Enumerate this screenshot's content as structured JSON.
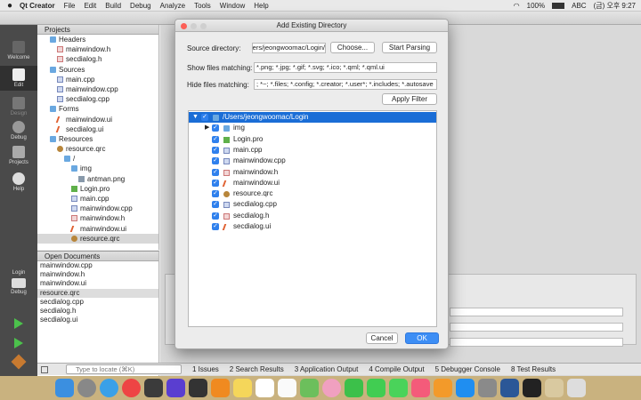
{
  "menubar": {
    "apple": "",
    "items": [
      "Qt Creator",
      "File",
      "Edit",
      "Build",
      "Debug",
      "Analyze",
      "Tools",
      "Window",
      "Help"
    ],
    "battery": "100%",
    "input": "ABC",
    "clock": "(금) 오후 9:27"
  },
  "modes": [
    "Welcome",
    "Edit",
    "Design",
    "Debug",
    "Projects",
    "Help"
  ],
  "kit": {
    "project": "Login",
    "mode": "Debug"
  },
  "projects_panel": {
    "title": "Projects",
    "tree": [
      {
        "label": "Headers",
        "icon": "folder-icon"
      },
      {
        "label": "mainwindow.h",
        "icon": "header-file-icon"
      },
      {
        "label": "secdialog.h",
        "icon": "header-file-icon"
      },
      {
        "label": "Sources",
        "icon": "folder-icon"
      },
      {
        "label": "main.cpp",
        "icon": "cpp-file-icon"
      },
      {
        "label": "mainwindow.cpp",
        "icon": "cpp-file-icon"
      },
      {
        "label": "secdialog.cpp",
        "icon": "cpp-file-icon"
      },
      {
        "label": "Forms",
        "icon": "folder-icon"
      },
      {
        "label": "mainwindow.ui",
        "icon": "ui-file-icon"
      },
      {
        "label": "secdialog.ui",
        "icon": "ui-file-icon"
      },
      {
        "label": "Resources",
        "icon": "folder-icon"
      },
      {
        "label": "resource.qrc",
        "icon": "qrc-file-icon"
      },
      {
        "label": "/",
        "icon": "folder-icon"
      },
      {
        "label": "img",
        "icon": "folder-icon"
      },
      {
        "label": "antman.png",
        "icon": "image-file-icon"
      },
      {
        "label": "Login.pro",
        "icon": "pro-file-icon"
      },
      {
        "label": "main.cpp",
        "icon": "cpp-file-icon"
      },
      {
        "label": "mainwindow.cpp",
        "icon": "cpp-file-icon"
      },
      {
        "label": "mainwindow.h",
        "icon": "header-file-icon"
      },
      {
        "label": "mainwindow.ui",
        "icon": "ui-file-icon"
      },
      {
        "label": "resource.qrc",
        "icon": "qrc-file-icon"
      }
    ]
  },
  "open_documents": {
    "title": "Open Documents",
    "items": [
      "mainwindow.cpp",
      "mainwindow.h",
      "mainwindow.ui",
      "resource.qrc",
      "secdialog.cpp",
      "secdialog.h",
      "secdialog.ui"
    ]
  },
  "bottom_bar": {
    "locator_placeholder": "Type to locate (⌘K)",
    "outputs": [
      "1 Issues",
      "2 Search Results",
      "3 Application Output",
      "4 Compile Output",
      "5 Debugger Console",
      "8 Test Results"
    ]
  },
  "dialog": {
    "title": "Add Existing Directory",
    "source_label": "Source directory:",
    "source_value": "/Users/jeongwoomac/Login",
    "choose_label": "Choose...",
    "parse_label": "Start Parsing",
    "show_label": "Show files matching:",
    "show_value": "*.png; *.jpg; *.gif; *.svg; *.ico; *.qml; *.qml.ui",
    "hide_label": "Hide files matching:",
    "hide_value": "; *~; *.files; *.config; *.creator; *.user*; *.includes; *.autosave",
    "apply_label": "Apply Filter",
    "tree": [
      {
        "label": "/Users/jeongwoomac/Login",
        "icon": "folder-icon"
      },
      {
        "label": "img",
        "icon": "folder-icon"
      },
      {
        "label": "Login.pro",
        "icon": "pro-file-icon"
      },
      {
        "label": "main.cpp",
        "icon": "cpp-file-icon"
      },
      {
        "label": "mainwindow.cpp",
        "icon": "cpp-file-icon"
      },
      {
        "label": "mainwindow.h",
        "icon": "header-file-icon"
      },
      {
        "label": "mainwindow.ui",
        "icon": "ui-file-icon"
      },
      {
        "label": "resource.qrc",
        "icon": "qrc-file-icon"
      },
      {
        "label": "secdialog.cpp",
        "icon": "cpp-file-icon"
      },
      {
        "label": "secdialog.h",
        "icon": "header-file-icon"
      },
      {
        "label": "secdialog.ui",
        "icon": "ui-file-icon"
      }
    ],
    "cancel_label": "Cancel",
    "ok_label": "OK"
  },
  "colors": {
    "accent": "#2f80ed",
    "selection": "#1a6dd6",
    "sidebar": "#4a4a4a",
    "dock": "#c9b27f"
  }
}
